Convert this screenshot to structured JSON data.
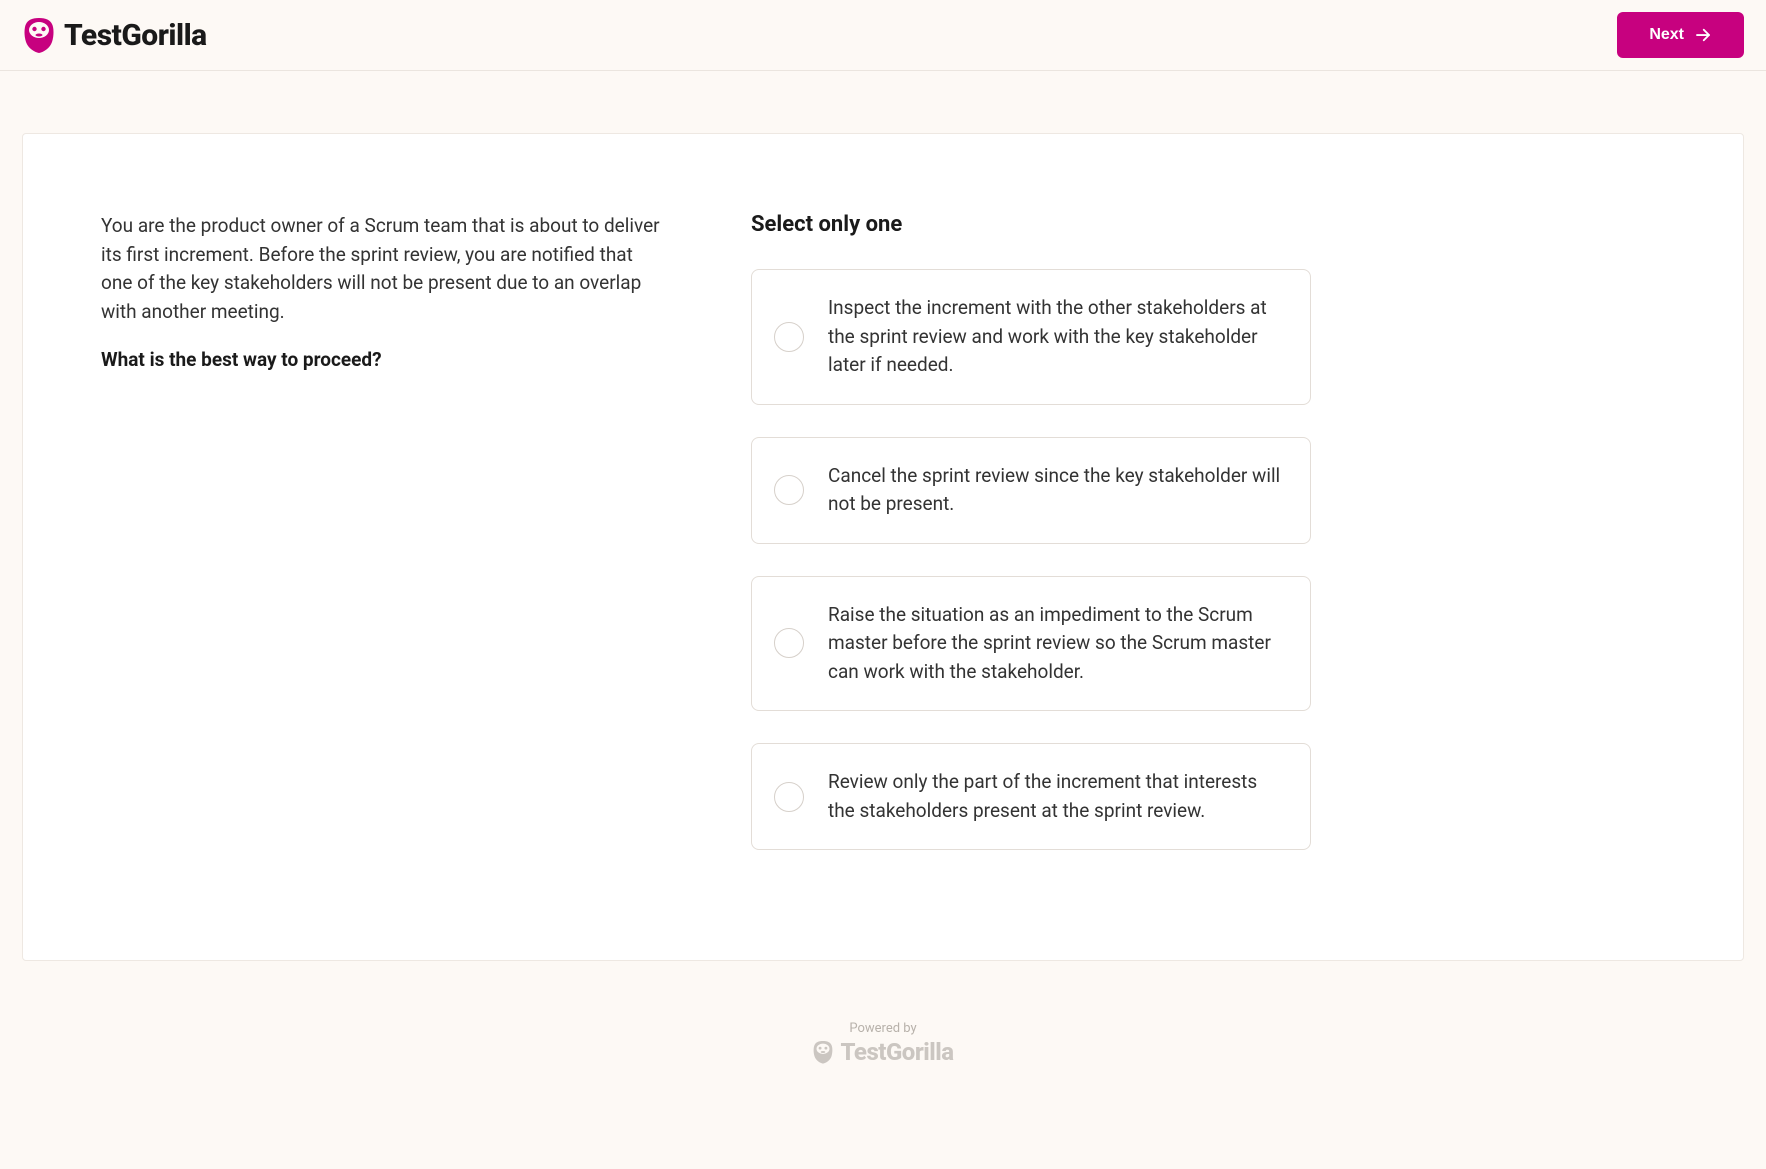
{
  "header": {
    "brand": "TestGorilla",
    "next_label": "Next"
  },
  "question": {
    "scenario": "You are the product owner of a Scrum team that is about to deliver its first increment. Before the sprint review, you are notified that one of the key stakeholders will not be present due to an overlap with another meeting.",
    "prompt": "What is the best way to proceed?"
  },
  "answers": {
    "heading": "Select only one",
    "options": [
      "Inspect the increment with the other stakeholders at the sprint review and work with the key stakeholder later if needed.",
      "Cancel the sprint review since the key stakeholder will not be present.",
      "Raise the situation as an impediment to the Scrum master before the sprint review so the Scrum master can work with the stakeholder.",
      "Review only the part of the increment that interests the stakeholders present at the sprint review."
    ]
  },
  "footer": {
    "powered_by": "Powered by",
    "brand": "TestGorilla"
  }
}
